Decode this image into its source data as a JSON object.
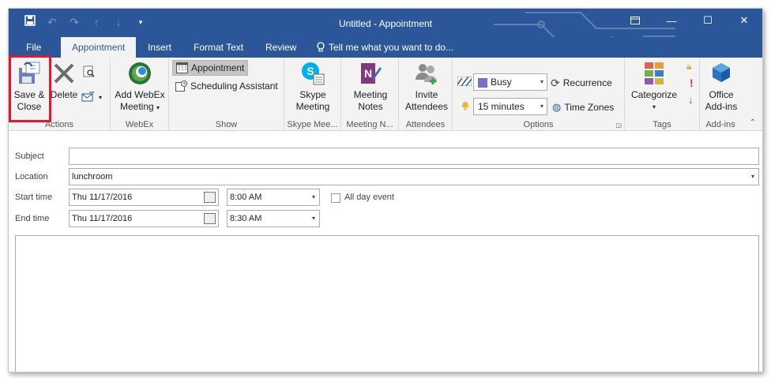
{
  "window": {
    "title": "Untitled - Appointment"
  },
  "quick_access": [
    "save-icon",
    "undo-icon",
    "redo-icon",
    "up-icon",
    "down-icon",
    "customize-icon"
  ],
  "tabs": [
    {
      "label": "File"
    },
    {
      "label": "Appointment",
      "active": true
    },
    {
      "label": "Insert"
    },
    {
      "label": "Format Text"
    },
    {
      "label": "Review"
    }
  ],
  "tell_me": {
    "label": "Tell me what you want to do..."
  },
  "ribbon": {
    "actions": {
      "label": "Actions",
      "save_close_line1": "Save &",
      "save_close_line2": "Close",
      "delete": "Delete"
    },
    "webex": {
      "label": "WebEx",
      "add_line1": "Add WebEx",
      "add_line2": "Meeting"
    },
    "show": {
      "label": "Show",
      "appointment": "Appointment",
      "scheduling": "Scheduling Assistant"
    },
    "skype": {
      "label": "Skype Mee...",
      "line1": "Skype",
      "line2": "Meeting"
    },
    "notes": {
      "label": "Meeting N...",
      "line1": "Meeting",
      "line2": "Notes"
    },
    "attendees": {
      "label": "Attendees",
      "line1": "Invite",
      "line2": "Attendees"
    },
    "options": {
      "label": "Options",
      "show_as": "Busy",
      "reminder": "15 minutes",
      "recurrence": "Recurrence",
      "time_zones": "Time Zones"
    },
    "tags": {
      "label": "Tags",
      "categorize": "Categorize"
    },
    "addins": {
      "label": "Add-ins",
      "line1": "Office",
      "line2": "Add-ins"
    }
  },
  "form": {
    "subject_label": "Subject",
    "subject_value": "",
    "location_label": "Location",
    "location_value": "lunchroom",
    "start_label": "Start time",
    "start_date": "Thu 11/17/2016",
    "start_time": "8:00 AM",
    "all_day_label": "All day event",
    "end_label": "End time",
    "end_date": "Thu 11/17/2016",
    "end_time": "8:30 AM"
  },
  "colors": {
    "accent": "#2b579a",
    "highlight": "#e2182c"
  }
}
